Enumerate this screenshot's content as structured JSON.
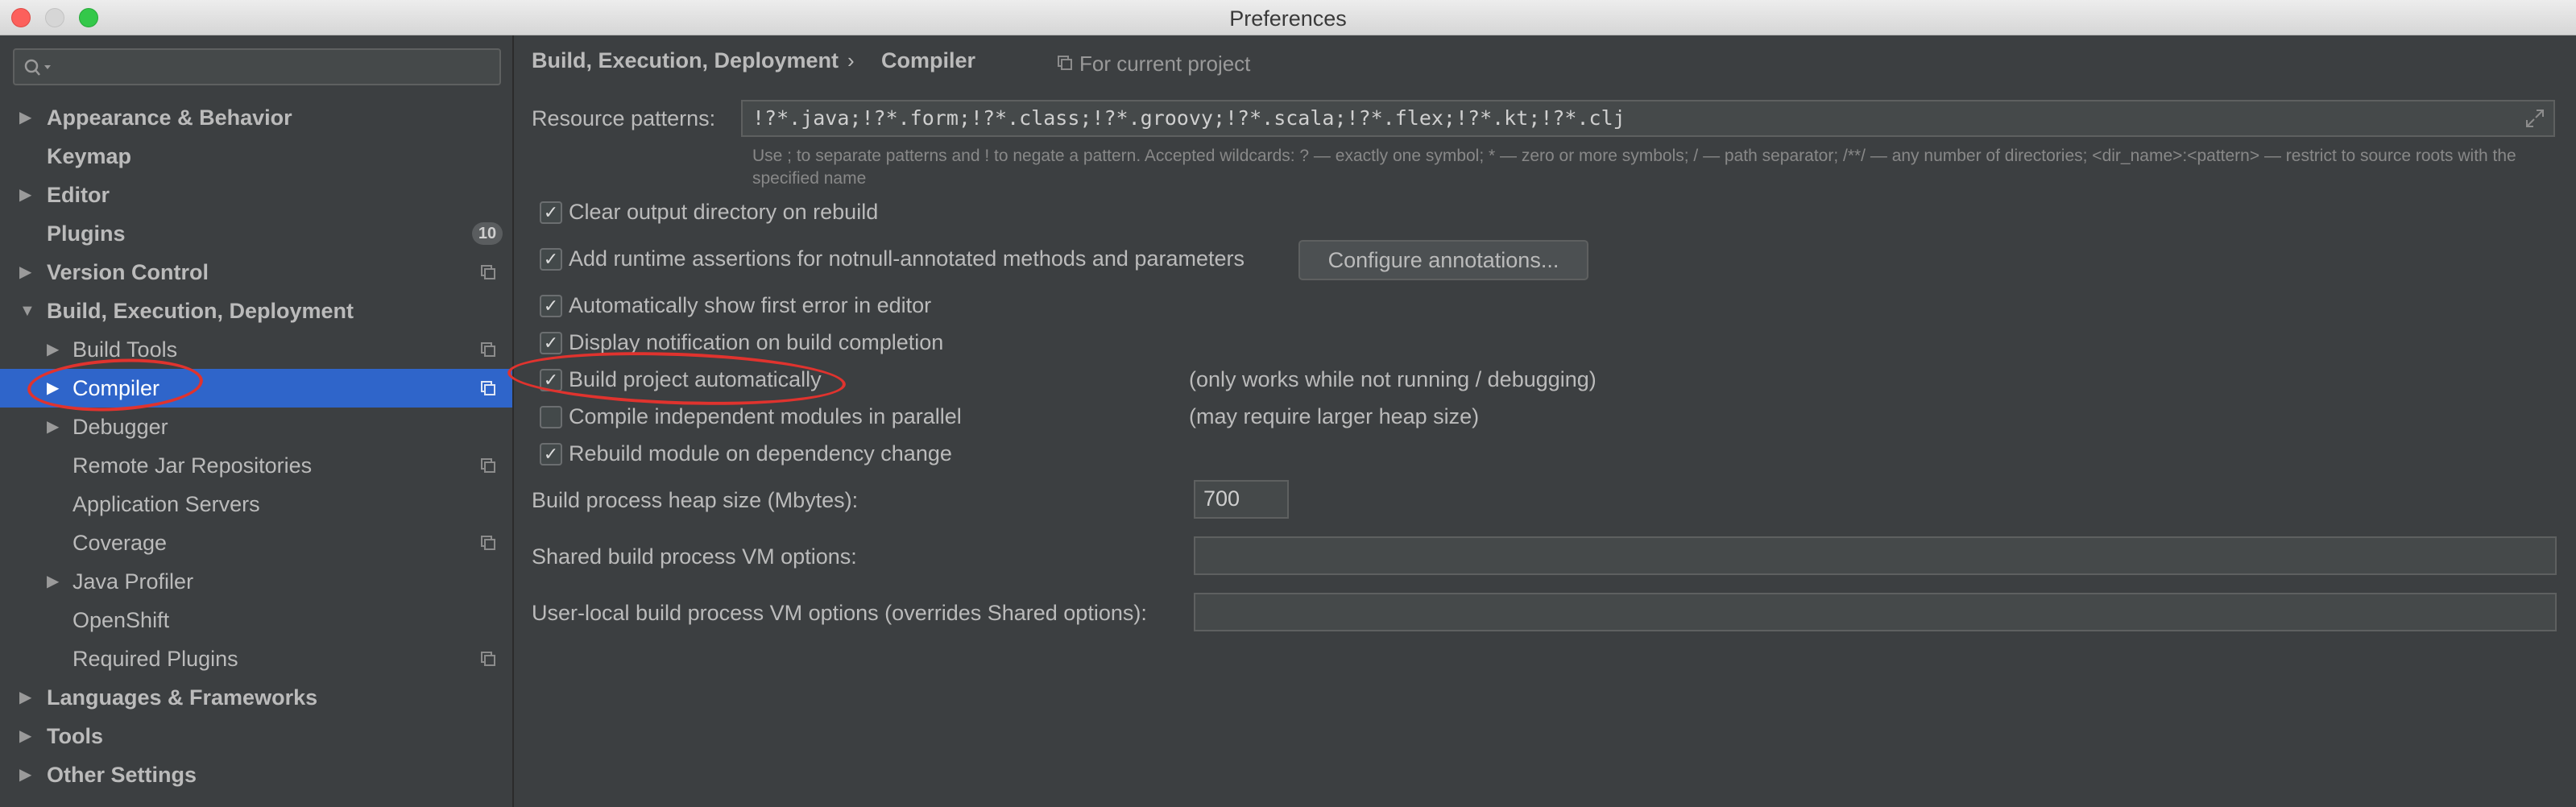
{
  "window": {
    "title": "Preferences"
  },
  "search": {
    "placeholder": ""
  },
  "sidebar": {
    "items": [
      {
        "label": "Appearance & Behavior"
      },
      {
        "label": "Keymap"
      },
      {
        "label": "Editor"
      },
      {
        "label": "Plugins",
        "badge": "10"
      },
      {
        "label": "Version Control"
      },
      {
        "label": "Build, Execution, Deployment"
      },
      {
        "label": "Build Tools"
      },
      {
        "label": "Compiler"
      },
      {
        "label": "Debugger"
      },
      {
        "label": "Remote Jar Repositories"
      },
      {
        "label": "Application Servers"
      },
      {
        "label": "Coverage"
      },
      {
        "label": "Java Profiler"
      },
      {
        "label": "OpenShift"
      },
      {
        "label": "Required Plugins"
      },
      {
        "label": "Languages & Frameworks"
      },
      {
        "label": "Tools"
      },
      {
        "label": "Other Settings"
      }
    ],
    "selected": "Compiler"
  },
  "breadcrumb": {
    "parent": "Build, Execution, Deployment",
    "separator": "›",
    "current": "Compiler",
    "scope": "For current project"
  },
  "resource_patterns": {
    "label": "Resource patterns:",
    "value": "!?*.java;!?*.form;!?*.class;!?*.groovy;!?*.scala;!?*.flex;!?*.kt;!?*.clj",
    "hint": "Use ; to separate patterns and ! to negate a pattern. Accepted wildcards: ? — exactly one symbol; * — zero or more symbols; / — path separator; /**/ — any number of directories; <dir_name>:<pattern> — restrict to source roots with the specified name"
  },
  "options": [
    {
      "label": "Clear output directory on rebuild",
      "checked": true,
      "mark": "✓"
    },
    {
      "label": "Add runtime assertions for notnull-annotated methods and parameters",
      "checked": true,
      "mark": "✓"
    },
    {
      "label": "Automatically show first error in editor",
      "checked": true,
      "mark": "✓"
    },
    {
      "label": "Display notification on build completion",
      "checked": true,
      "mark": "✓"
    },
    {
      "label": "Build project automatically",
      "checked": true,
      "mark": "✓",
      "note": "(only works while not running / debugging)"
    },
    {
      "label": "Compile independent modules in parallel",
      "checked": false,
      "mark": "",
      "note": "(may require larger heap size)"
    },
    {
      "label": "Rebuild module on dependency change",
      "checked": true,
      "mark": "✓"
    }
  ],
  "configure_button": "Configure annotations...",
  "heap": {
    "label": "Build process heap size (Mbytes):",
    "value": "700"
  },
  "shared_vm": {
    "label": "Shared build process VM options:",
    "value": ""
  },
  "user_vm": {
    "label": "User-local build process VM options (overrides Shared options):",
    "value": ""
  },
  "colors": {
    "selection": "#2f65ca",
    "annotation": "#e0332e",
    "background": "#3c3f41"
  }
}
